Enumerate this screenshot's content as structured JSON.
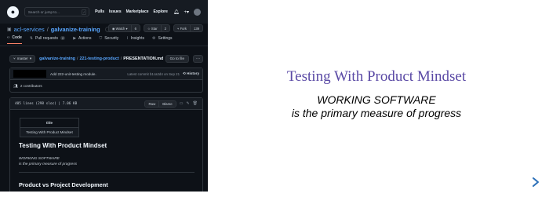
{
  "colors": {
    "slide_title": "#5a49a5",
    "gh_bg": "#0d1117",
    "gh_link": "#58a6ff"
  },
  "github": {
    "search_placeholder": "Search or jump to...",
    "search_key": "/",
    "nav": [
      "Pulls",
      "Issues",
      "Marketplace",
      "Explore"
    ],
    "header_icons": [
      "bell-icon",
      "plus-icon",
      "avatar"
    ],
    "repo": {
      "owner": "acl-services",
      "separator": "/",
      "name": "galvanize-training",
      "visibility": "Private"
    },
    "actions": [
      {
        "label": "Watch",
        "count": "6",
        "icon": "eye-icon"
      },
      {
        "label": "Star",
        "count": "2",
        "icon": "star-icon"
      },
      {
        "label": "Fork",
        "count": "139",
        "icon": "fork-icon"
      }
    ],
    "tabs": [
      {
        "label": "Code",
        "icon": "code-icon",
        "selected": true
      },
      {
        "label": "Pull requests",
        "icon": "pull-request-icon",
        "badge": "2"
      },
      {
        "label": "Actions",
        "icon": "play-icon"
      },
      {
        "label": "Security",
        "icon": "shield-icon"
      },
      {
        "label": "Insights",
        "icon": "graph-icon"
      },
      {
        "label": "Settings",
        "icon": "gear-icon"
      }
    ],
    "branch": "master",
    "breadcrumb": {
      "repo": "galvanize-training",
      "folder": "221-testing-product",
      "file": "PRESENTATION.md"
    },
    "goto_file": "Go to file",
    "more": "···",
    "commit": {
      "message": "Add 222-unit-testing module.",
      "meta": "Latest commit b1ca2d4 on Sep 21",
      "history": "History"
    },
    "contributors": "2 contributors",
    "file": {
      "info": "405 lines (298 sloc)  |  7.06 KB",
      "raw": "Raw",
      "blame": "Blame",
      "tool_icons": [
        "desktop-icon",
        "pencil-icon",
        "trash-icon"
      ]
    },
    "markdown": {
      "table_header": "title",
      "table_cell": "Testing With Product Mindset",
      "h1": "Testing With Product Mindset",
      "em_line1": "WORKING SOFTWARE",
      "em_line2": "is the primary measure of progress",
      "h2": "Product vs Project Development"
    }
  },
  "slide": {
    "title": "Testing With Product Mindset",
    "subtitle_line1": "WORKING SOFTWARE",
    "subtitle_line2": "is the primary measure of progress",
    "next_icon": "chevron-right-icon"
  }
}
